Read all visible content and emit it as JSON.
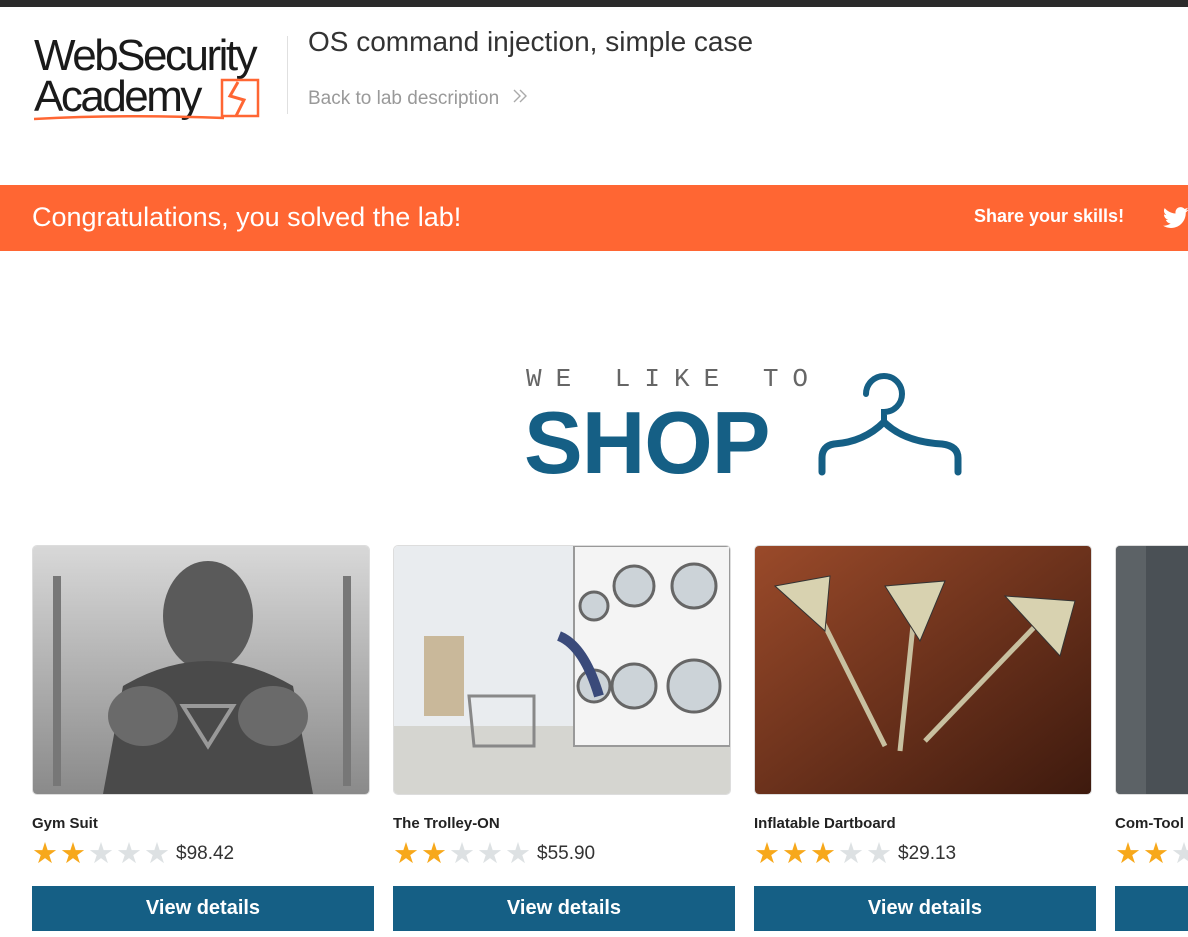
{
  "header": {
    "logo_line1": "WebSecurity",
    "logo_line2": "Academy",
    "lab_title": "OS command injection, simple case",
    "back_link": "Back to lab description",
    "back_icon": "chevrons-right-icon"
  },
  "banner": {
    "message": "Congratulations, you solved the lab!",
    "share_label": "Share your skills!",
    "share_icon": "twitter-icon",
    "color": "#ff6633"
  },
  "shop_logo": {
    "tagline": "WE LIKE TO",
    "word": "SHOP",
    "icon": "hanger-icon",
    "color": "#155f85"
  },
  "products": [
    {
      "name": "Gym Suit",
      "rating": 2,
      "price": "$98.42",
      "button": "View details",
      "image": "bodybuilder-dog-photo"
    },
    {
      "name": "The Trolley-ON",
      "rating": 2,
      "price": "$55.90",
      "button": "View details",
      "image": "laundromat-photo"
    },
    {
      "name": "Inflatable Dartboard",
      "rating": 3,
      "price": "$29.13",
      "button": "View details",
      "image": "darts-photo"
    },
    {
      "name": "Com-Tool",
      "rating": 2,
      "price": "",
      "button": "",
      "image": "dark-photo"
    }
  ],
  "colors": {
    "accent_orange": "#ff6633",
    "button_blue": "#155f85",
    "star_on": "#f7a81b",
    "star_off": "#dde1e3"
  }
}
